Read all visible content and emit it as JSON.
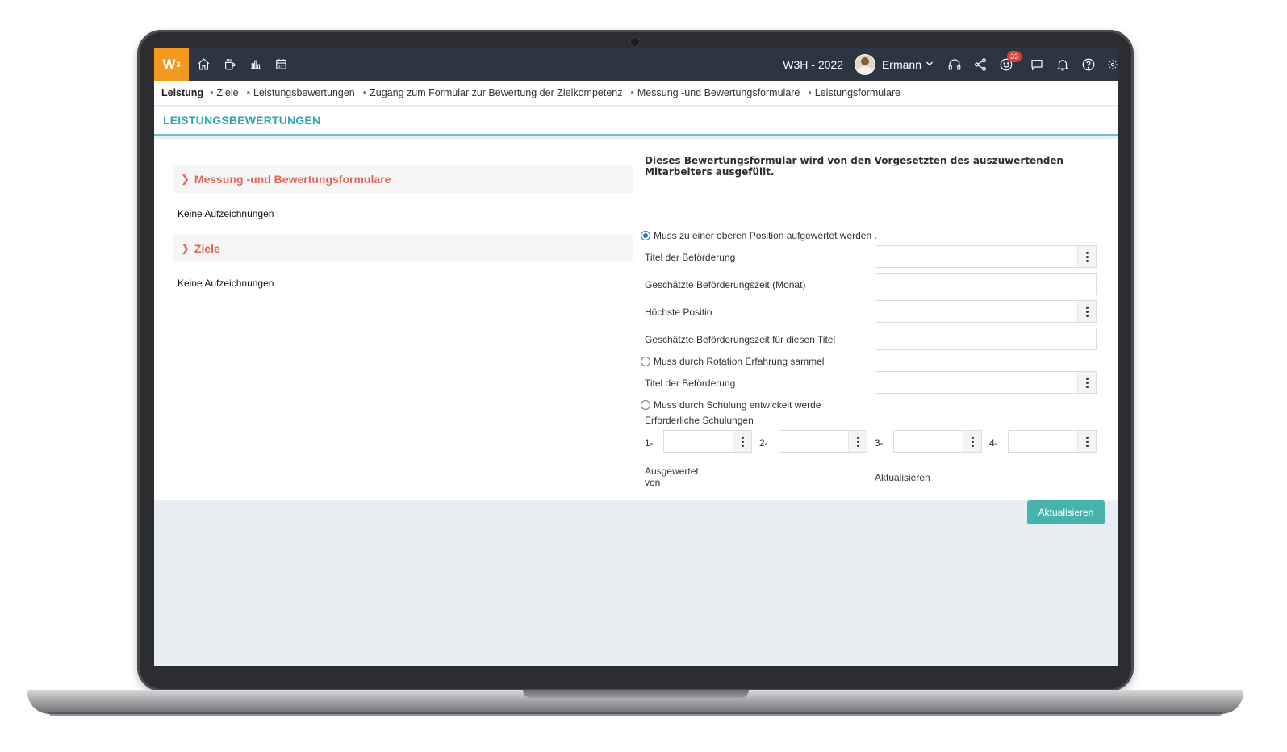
{
  "app": {
    "logo_text": "W",
    "logo_sup": "3",
    "year_label": "W3H - 2022",
    "user_name": "Ermann",
    "notification_count": "33",
    "accent_color": "#f39a1e",
    "topbar_color": "#2c3642"
  },
  "breadcrumb": {
    "items": [
      "Leistung",
      "Ziele",
      "Leistungsbewertungen",
      "Zugang zum Formular zur Bewertung der Zielkompetenz",
      "Messung -und Bewertungsformulare",
      "Leistungsformulare"
    ]
  },
  "page": {
    "title": "LEISTUNGSBEWERTUNGEN"
  },
  "left": {
    "sections": [
      {
        "label": "Messung -und Bewertungsformulare",
        "empty": "Keine Aufzeichnungen !"
      },
      {
        "label": "Ziele",
        "empty": "Keine Aufzeichnungen !"
      }
    ]
  },
  "form": {
    "title": "Dieses Bewertungsformular wird von den Vorgesetzten des auszuwertenden Mitarbeiters ausgefüllt.",
    "option1": "Muss zu einer oberen Position aufgewertet werden .",
    "option1_checked": true,
    "label_title": "Titel der Beförderung",
    "label_time": "Geschätzte Beförderungszeit (Monat)",
    "label_highest": "Höchste Positio",
    "label_time_title": "Geschätzte Beförderungszeit für diesen Titel",
    "option2": "Muss durch Rotation Erfahrung sammel",
    "label_title2": "Titel der Beförderung",
    "option3": "Muss durch Schulung entwickelt werde",
    "label_trainings": "Erforderliche Schulungen",
    "training_nums": [
      "1-",
      "2-",
      "3-",
      "4-"
    ],
    "evaluated_by": "Ausgewertet von",
    "updated_text": "Aktualisieren",
    "submit_label": "Aktualisieren",
    "submit_color": "#46b3ad"
  }
}
